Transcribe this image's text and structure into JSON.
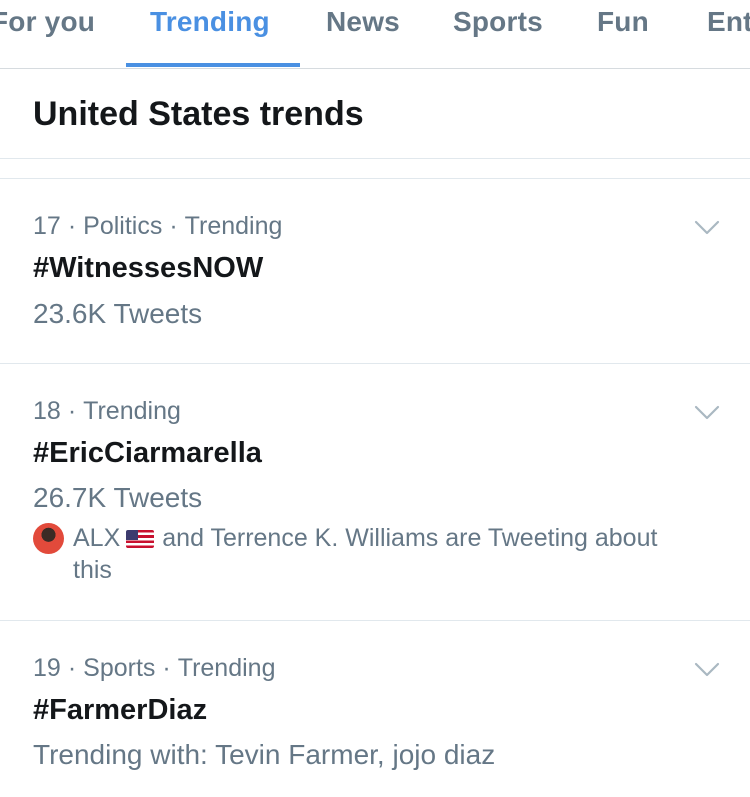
{
  "tabs": [
    {
      "label": "For you"
    },
    {
      "label": "Trending"
    },
    {
      "label": "News"
    },
    {
      "label": "Sports"
    },
    {
      "label": "Fun"
    },
    {
      "label": "Ent"
    }
  ],
  "active_tab": "Trending",
  "colors": {
    "accent": "#4a90e2",
    "secondary_text": "#657786",
    "primary_text": "#14171a"
  },
  "section": {
    "title": "United States trends"
  },
  "trends": [
    {
      "rank": "17",
      "category": "Politics",
      "status": "Trending",
      "hashtag": "#WitnessesNOW",
      "tweets": "23.6K Tweets"
    },
    {
      "rank": "18",
      "status": "Trending",
      "hashtag": "#EricCiarmarella",
      "tweets": "26.7K Tweets",
      "social": {
        "user": "ALX",
        "flag_icon": "us-flag-icon",
        "rest_line1": "and Terrence K. Williams are Tweeting about",
        "rest_line2": "this"
      }
    },
    {
      "rank": "19",
      "category": "Sports",
      "status": "Trending",
      "hashtag": "#FarmerDiaz",
      "trending_with": "Trending with: Tevin Farmer, jojo diaz"
    }
  ]
}
